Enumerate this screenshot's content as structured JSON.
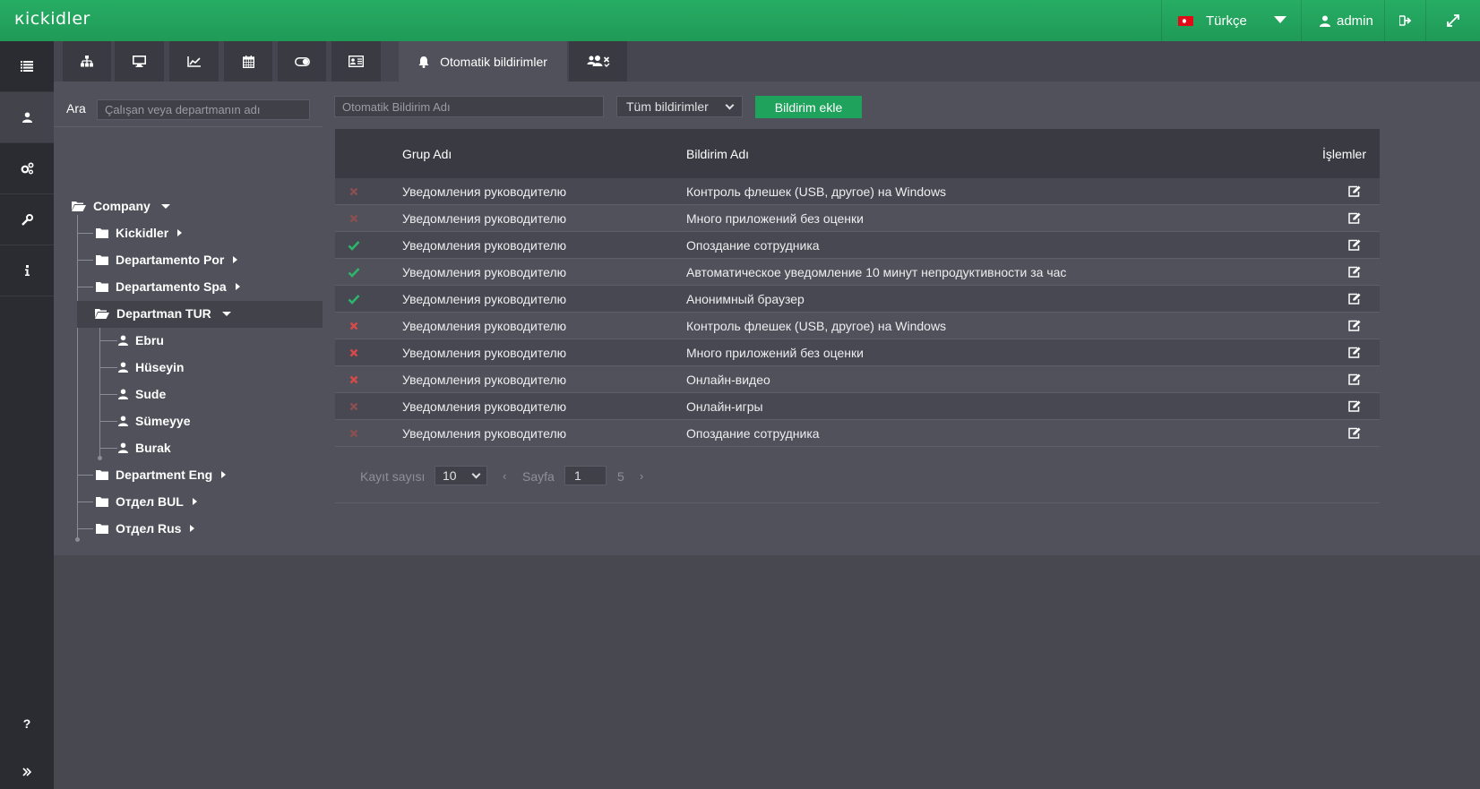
{
  "app": {
    "logo": "кіckidler"
  },
  "topbar": {
    "language": "Türkçe",
    "user": "admin"
  },
  "tabs": {
    "active_label": "Otomatik bildirimler"
  },
  "tree": {
    "search_label": "Ara",
    "search_placeholder": "Çalışan veya departmanın adı",
    "root": "Company",
    "departments": [
      "Kickidler",
      "Departamento Por",
      "Departamento Spa",
      "Departman TUR",
      "Department Eng",
      "Отдел BUL",
      "Отдел Rus"
    ],
    "employees": [
      "Ebru",
      "Hüseyin",
      "Sude",
      "Sümeyye",
      "Burak"
    ]
  },
  "toolbar": {
    "search_placeholder": "Otomatik Bildirim Adı",
    "filter_value": "Tüm bildirimler",
    "add_label": "Bildirim ekle"
  },
  "table": {
    "headers": {
      "group": "Grup Adı",
      "name": "Bildirim Adı",
      "actions": "İşlemler"
    },
    "rows": [
      {
        "status": "off-dim",
        "group": "Уведомления руководителю",
        "name": "Контроль флешек (USB, другое) на Windows"
      },
      {
        "status": "off-dim",
        "group": "Уведомления руководителю",
        "name": "Много приложений без оценки"
      },
      {
        "status": "on",
        "group": "Уведомления руководителю",
        "name": "Опоздание сотрудника"
      },
      {
        "status": "on",
        "group": "Уведомления руководителю",
        "name": "Автоматическое уведомление 10 минут непродуктивности за час"
      },
      {
        "status": "on",
        "group": "Уведомления руководителю",
        "name": "Анонимный браузер"
      },
      {
        "status": "off",
        "group": "Уведомления руководителю",
        "name": "Контроль флешек (USB, другое) на Windows"
      },
      {
        "status": "off",
        "group": "Уведомления руководителю",
        "name": "Много приложений без оценки"
      },
      {
        "status": "off",
        "group": "Уведомления руководителю",
        "name": "Онлайн-видео"
      },
      {
        "status": "off-dim",
        "group": "Уведомления руководителю",
        "name": "Онлайн-игры"
      },
      {
        "status": "off-dim",
        "group": "Уведомления руководителю",
        "name": "Опоздание сотрудника"
      }
    ]
  },
  "pagination": {
    "records_label": "Kayıt sayısı",
    "records_value": "10",
    "prev": "‹",
    "page_label": "Sayfa",
    "page_value": "1",
    "total_pages": "5",
    "next": "›"
  },
  "colors": {
    "accent": "#1fa35c",
    "status_on": "#2db66a",
    "status_off": "#d84a4a",
    "status_off_dim": "#8a4f51"
  }
}
